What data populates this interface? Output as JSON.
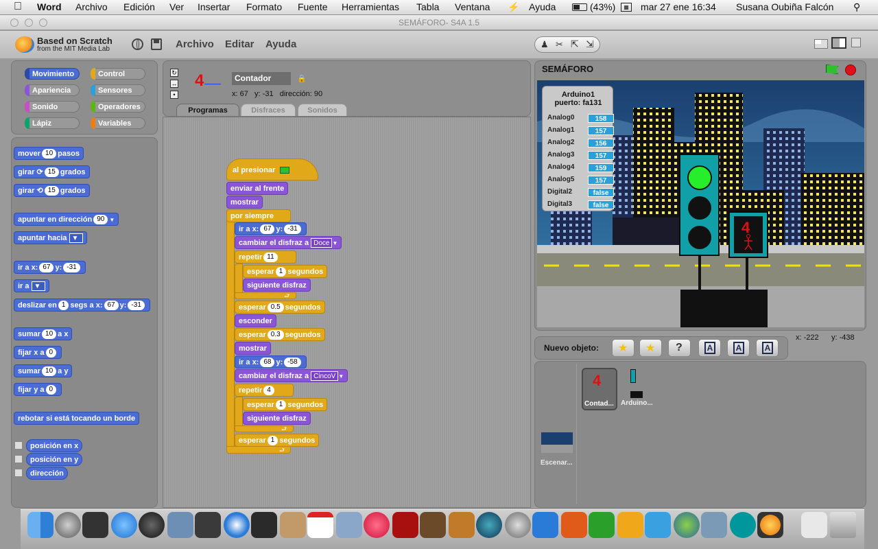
{
  "menubar": {
    "app": "Word",
    "items": [
      "Archivo",
      "Edición",
      "Ver",
      "Insertar",
      "Formato",
      "Fuente",
      "Herramientas",
      "Tabla",
      "Ventana",
      "Ayuda"
    ],
    "battery": "(43%)",
    "datetime": "mar 27 ene  16:34",
    "user": "Susana Oubiña Falcón"
  },
  "window": {
    "title": "SEMÁFORO- S4A 1.5"
  },
  "toolbar": {
    "logo_line1": "Based on Scratch",
    "logo_line2": "from the MIT Media Lab",
    "menu": [
      "Archivo",
      "Editar",
      "Ayuda"
    ]
  },
  "categories": [
    {
      "label": "Movimiento",
      "color": "#4a6cd4",
      "selected": true
    },
    {
      "label": "Control",
      "color": "#e1a91a"
    },
    {
      "label": "Apariencia",
      "color": "#8a55d7"
    },
    {
      "label": "Sensores",
      "color": "#2a9fd8"
    },
    {
      "label": "Sonido",
      "color": "#c64fc6"
    },
    {
      "label": "Operadores",
      "color": "#5cb712"
    },
    {
      "label": "Lápiz",
      "color": "#0aa36a"
    },
    {
      "label": "Variables",
      "color": "#ee7d16"
    }
  ],
  "palette": {
    "mover": {
      "a": "mover",
      "n": "10",
      "b": "pasos"
    },
    "girar_r": {
      "a": "girar",
      "n": "15",
      "b": "grados"
    },
    "girar_l": {
      "a": "girar",
      "n": "15",
      "b": "grados"
    },
    "apuntar_dir": {
      "a": "apuntar en dirección",
      "n": "90"
    },
    "apuntar_hacia": "apuntar hacia",
    "ir_a_xy": {
      "a": "ir a x:",
      "x": "67",
      "b": "y:",
      "y": "-31"
    },
    "ir_a": "ir a",
    "deslizar": {
      "a": "deslizar en",
      "n": "1",
      "b": "segs a x:",
      "x": "67",
      "c": "y:",
      "y": "-31"
    },
    "sumar_x": {
      "a": "sumar",
      "n": "10",
      "b": "a x"
    },
    "fijar_x": {
      "a": "fijar x a",
      "n": "0"
    },
    "sumar_y": {
      "a": "sumar",
      "n": "10",
      "b": "a y"
    },
    "fijar_y": {
      "a": "fijar y a",
      "n": "0"
    },
    "rebotar": "rebotar si está tocando un borde",
    "pos_x": "posición en x",
    "pos_y": "posición en y",
    "direccion": "dirección"
  },
  "sprite": {
    "thumb": "4",
    "name": "Contador",
    "x_label": "x:",
    "x": "67",
    "y_label": "y:",
    "y": "-31",
    "dir_label": "dirección:",
    "dir": "90",
    "tabs": [
      "Programas",
      "Disfraces",
      "Sonidos"
    ]
  },
  "script": {
    "hat": "al presionar",
    "enviar": "enviar al frente",
    "mostrar": "mostrar",
    "siempre": "por siempre",
    "ir1": {
      "a": "ir a x:",
      "x": "67",
      "b": "y:",
      "y": "-31"
    },
    "disfraz1": {
      "a": "cambiar el disfraz a",
      "v": "Doce"
    },
    "repetir1": {
      "a": "repetir",
      "n": "11"
    },
    "esperar1": {
      "a": "esperar",
      "n": "1",
      "b": "segundos"
    },
    "siguiente": "siguiente disfraz",
    "esperar2": {
      "a": "esperar",
      "n": "0.5",
      "b": "segundos"
    },
    "esconder": "esconder",
    "esperar3": {
      "a": "esperar",
      "n": "0.3",
      "b": "segundos"
    },
    "mostrar2": "mostrar",
    "ir2": {
      "a": "ir a x:",
      "x": "68",
      "b": "y:",
      "y": "-58"
    },
    "disfraz2": {
      "a": "cambiar el disfraz a",
      "v": "CincoV"
    },
    "repetir2": {
      "a": "repetir",
      "n": "4"
    },
    "esperar4": {
      "a": "esperar",
      "n": "1",
      "b": "segundos"
    },
    "siguiente2": "siguiente disfraz",
    "esperar5": {
      "a": "esperar",
      "n": "1",
      "b": "segundos"
    }
  },
  "stage": {
    "title": "SEMÁFORO",
    "board": "Arduino1",
    "port": "puerto: fa131",
    "sensors": [
      {
        "name": "Analog0",
        "value": "158"
      },
      {
        "name": "Analog1",
        "value": "157"
      },
      {
        "name": "Analog2",
        "value": "156"
      },
      {
        "name": "Analog3",
        "value": "157"
      },
      {
        "name": "Analog4",
        "value": "159"
      },
      {
        "name": "Analog5",
        "value": "157"
      },
      {
        "name": "Digital2",
        "value": "false"
      },
      {
        "name": "Digital3",
        "value": "false"
      }
    ],
    "counter": "4",
    "mouse_x": "x: -222",
    "mouse_y": "y: -438"
  },
  "sprites_panel": {
    "new_object": "Nuevo objeto:",
    "sprite1_thumb": "4",
    "sprite1": "Contad...",
    "sprite2": "Arduino...",
    "stage": "Escenar..."
  },
  "colors": {
    "motion": "#4a6cd4",
    "looks": "#8a55d7",
    "control": "#e1a91a",
    "sensing": "#2a9fd8"
  }
}
